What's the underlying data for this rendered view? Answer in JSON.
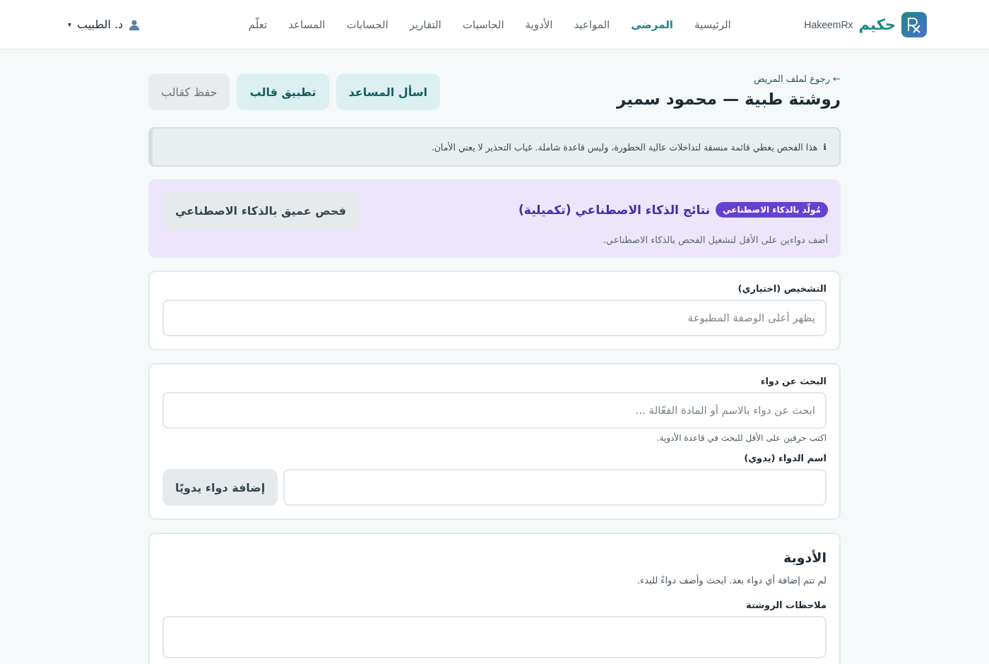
{
  "brand": {
    "name": "حكيم",
    "latin": "HakeemRx"
  },
  "nav": [
    {
      "label": "الرئيسية",
      "selected": false
    },
    {
      "label": "المرضى",
      "selected": true
    },
    {
      "label": "المواعيد",
      "selected": false
    },
    {
      "label": "الأدوية",
      "selected": false
    },
    {
      "label": "الحاسبات",
      "selected": false
    },
    {
      "label": "التقارير",
      "selected": false
    },
    {
      "label": "الحسابات",
      "selected": false
    },
    {
      "label": "المساعد",
      "selected": false
    },
    {
      "label": "تعلّم",
      "selected": false
    }
  ],
  "user": {
    "name": "د. الطبيب",
    "caret": "▾"
  },
  "back_link": "← رجوع لملف المريض",
  "page_title": "روشتة طبية — محمود سمير",
  "actions": [
    {
      "label": "اسأل المساعد",
      "kind": "primary"
    },
    {
      "label": "تطبيق قالب",
      "kind": "primary"
    },
    {
      "label": "حفظ كقالب",
      "kind": "secondary"
    }
  ],
  "notice": {
    "icon": "ℹ",
    "text": "هذا الفحص يغطي قائمة منسقة لتداخلات عالية الخطورة، وليس قاعدة شاملة. غياب التحذير لا يعني الأمان."
  },
  "ai_panel": {
    "badge": "مُولّد بالذكاء الاصطناعي",
    "title": "نتائج الذكاء الاصطناعي (تكميلية)",
    "hint": "أضف دواءين على الأقل لتشغيل الفحص بالذكاء الاصطناعي.",
    "button": "فحص عميق بالذكاء الاصطناعي"
  },
  "diagnosis": {
    "label": "التشخيص (اختياري)",
    "placeholder": "يظهر أعلى الوصفة المطبوعة"
  },
  "drug_search": {
    "label": "البحث عن دواء",
    "placeholder": "ابحث عن دواء بالاسم أو المادة الفعّالة ...",
    "help": "اكتب حرفين على الأقل للبحث في قاعدة الأدوية.",
    "manual_label": "اسم الدواء (يدوي)",
    "manual_button": "إضافة دواء يدويًا"
  },
  "medications": {
    "title": "الأدوية",
    "empty": "لم تتم إضافة أي دواء بعد. ابحث وأضف دواءً للبدء.",
    "notes_label": "ملاحظات الروشتة"
  }
}
